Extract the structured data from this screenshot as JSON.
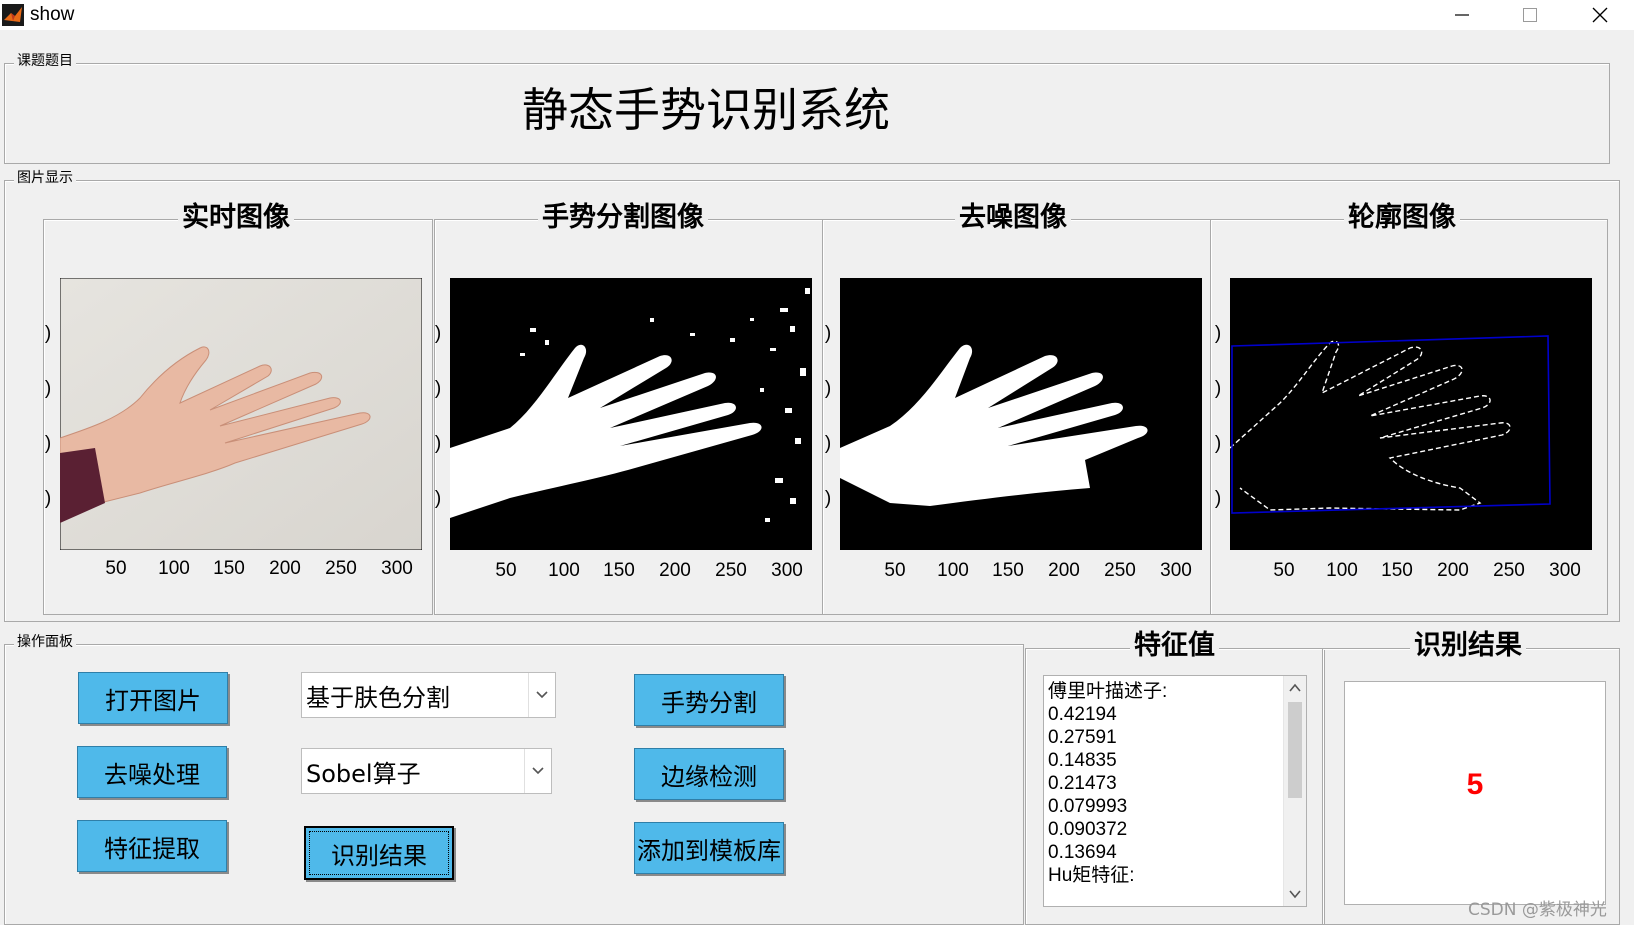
{
  "window": {
    "title": "show",
    "controls": {
      "minimize": "minimize-icon",
      "maximize": "maximize-icon",
      "close": "close-icon"
    }
  },
  "topic_panel": {
    "label": "课题题目",
    "title": "静态手势识别系统"
  },
  "image_panel": {
    "label": "图片显示",
    "views": [
      {
        "title": "实时图像"
      },
      {
        "title": "手势分割图像"
      },
      {
        "title": "去噪图像"
      },
      {
        "title": "轮廓图像"
      }
    ],
    "x_ticks": [
      "50",
      "100",
      "150",
      "200",
      "250",
      "300"
    ],
    "y_tick_stub": ")"
  },
  "operation_panel": {
    "label": "操作面板",
    "buttons": {
      "open_image": "打开图片",
      "denoise": "去噪处理",
      "feature_extract": "特征提取",
      "recognize": "识别结果",
      "segment": "手势分割",
      "edge_detect": "边缘检测",
      "add_template": "添加到模板库"
    },
    "segment_method": {
      "selected": "基于肤色分割"
    },
    "edge_operator": {
      "selected": "Sobel算子"
    }
  },
  "feature_panel": {
    "title": "特征值",
    "lines": [
      "傅里叶描述子:",
      "0.42194",
      "0.27591",
      "0.14835",
      "0.21473",
      "0.079993",
      "0.090372",
      "0.13694",
      "Hu矩特征:"
    ]
  },
  "result_panel": {
    "title": "识别结果",
    "value": "5",
    "value_color": "#ff0000"
  },
  "colors": {
    "button_bg": "#4fb9ea",
    "window_bg": "#f0f0f0",
    "bbox_line": "#0000cc"
  },
  "watermark": "CSDN @紫极神光"
}
